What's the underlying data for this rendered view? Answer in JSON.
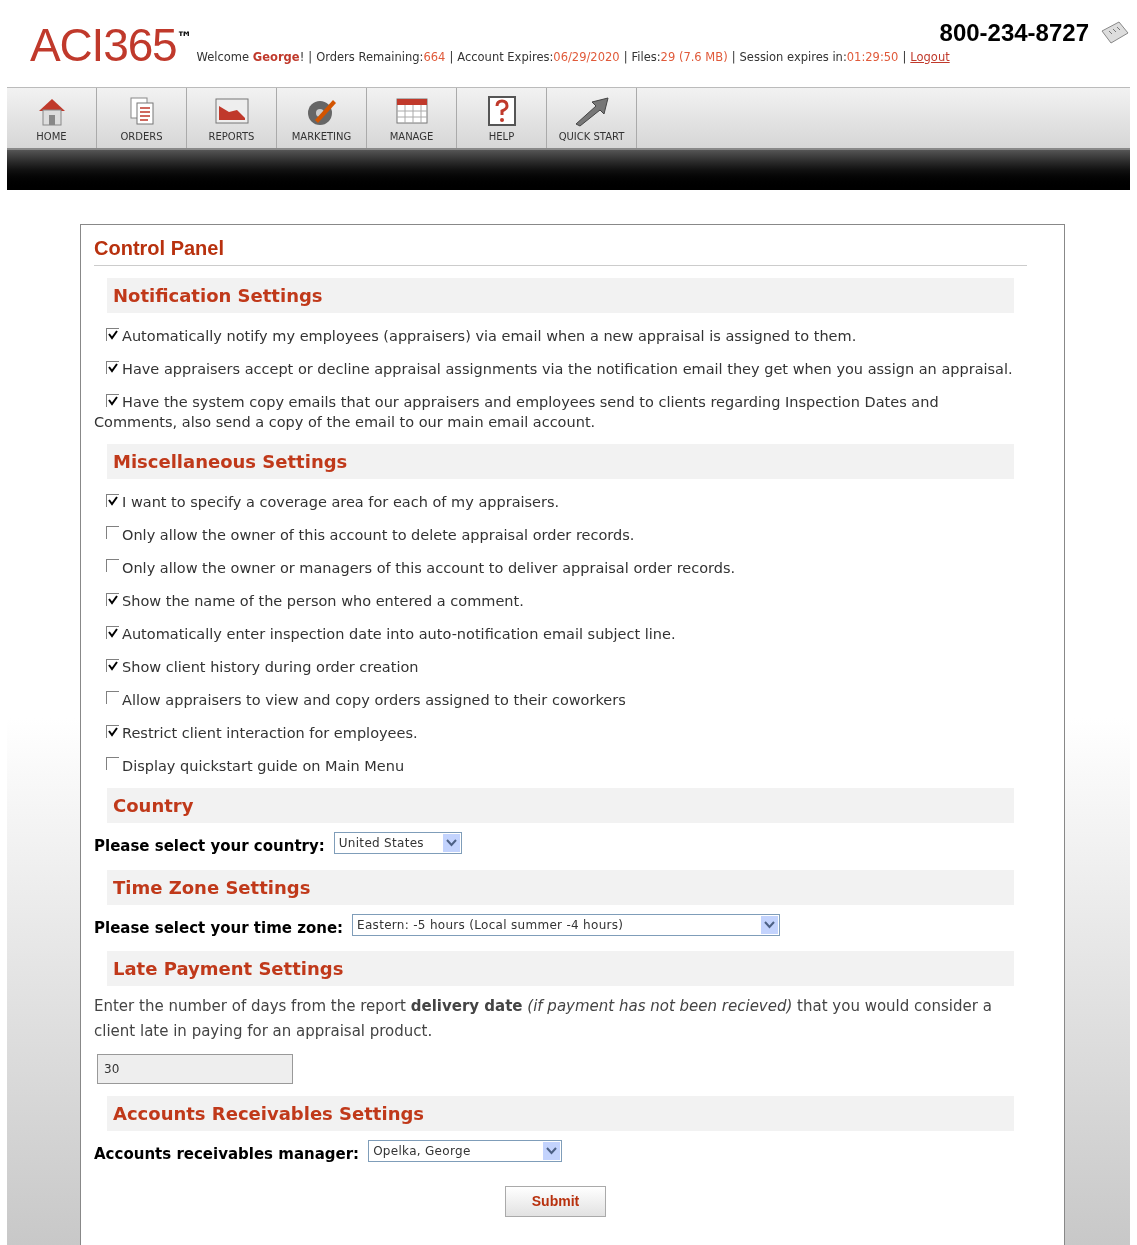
{
  "header": {
    "logo": "ACI365",
    "logo_mark": "™",
    "phone": "800-234-8727",
    "separator": "|",
    "status": [
      {
        "label": "Welcome ",
        "value": "George",
        "suffix": "!"
      },
      {
        "label": "Orders Remaining:",
        "value": "664"
      },
      {
        "label": "Account Expires:",
        "value": "06/29/2020"
      },
      {
        "label": "Files:",
        "value": "29 (7.6 MB)"
      },
      {
        "label": "Session expires in:",
        "value": "01:29:50"
      }
    ],
    "logout": "Logout"
  },
  "nav": [
    {
      "label": "HOME",
      "kind": "home"
    },
    {
      "label": "ORDERS",
      "kind": "orders"
    },
    {
      "label": "REPORTS",
      "kind": "reports"
    },
    {
      "label": "MARKETING",
      "kind": "marketing"
    },
    {
      "label": "MANAGE",
      "kind": "manage"
    },
    {
      "label": "HELP",
      "kind": "help"
    },
    {
      "label": "QUICK START",
      "kind": "quickstart"
    }
  ],
  "panel": {
    "title": "Control Panel",
    "sections": [
      {
        "title": "Notification Settings",
        "kind": "checkboxes",
        "options": [
          {
            "label": "Automatically notify my employees (appraisers) via email when a new appraisal is assigned to them.",
            "checked": true
          },
          {
            "label": "Have appraisers accept or decline appraisal assignments via the notification email they get when you assign an appraisal.",
            "checked": true
          },
          {
            "label": "Have the system copy emails that our appraisers and employees send to clients regarding Inspection Dates and Comments, also send a copy of the email to our main email account.",
            "checked": true
          }
        ]
      },
      {
        "title": "Miscellaneous Settings",
        "kind": "checkboxes",
        "options": [
          {
            "label": "I want to specify a coverage area for each of my appraisers.",
            "checked": true
          },
          {
            "label": "Only allow the owner of this account to delete appraisal order records.",
            "checked": false
          },
          {
            "label": "Only allow the owner or managers of this account to deliver appraisal order records.",
            "checked": false
          },
          {
            "label": "Show the name of the person who entered a comment.",
            "checked": true
          },
          {
            "label": "Automatically enter inspection date into auto-notification email subject line.",
            "checked": true
          },
          {
            "label": "Show client history during order creation",
            "checked": true
          },
          {
            "label": "Allow appraisers to view and copy orders assigned to their coworkers",
            "checked": false
          },
          {
            "label": "Restrict client interaction for employees.",
            "checked": true
          },
          {
            "label": "Display quickstart guide on Main Menu",
            "checked": false
          }
        ]
      },
      {
        "title": "Country",
        "kind": "select",
        "label": "Please select your country:",
        "value": "United States"
      },
      {
        "title": "Time Zone Settings",
        "kind": "select",
        "label": "Please select your time zone:",
        "value": "Eastern: -5 hours (Local summer -4 hours)"
      },
      {
        "title": "Late Payment Settings",
        "kind": "text_input",
        "description": "Enter the number of days from the report **delivery date** *(if payment has not been recieved)* that you would consider a client late in paying for an appraisal product.",
        "value": "30"
      },
      {
        "title": "Accounts Receivables Settings",
        "kind": "select",
        "label": "Accounts receivables manager:",
        "value": "Opelka, George"
      }
    ],
    "submit": "Submit"
  }
}
